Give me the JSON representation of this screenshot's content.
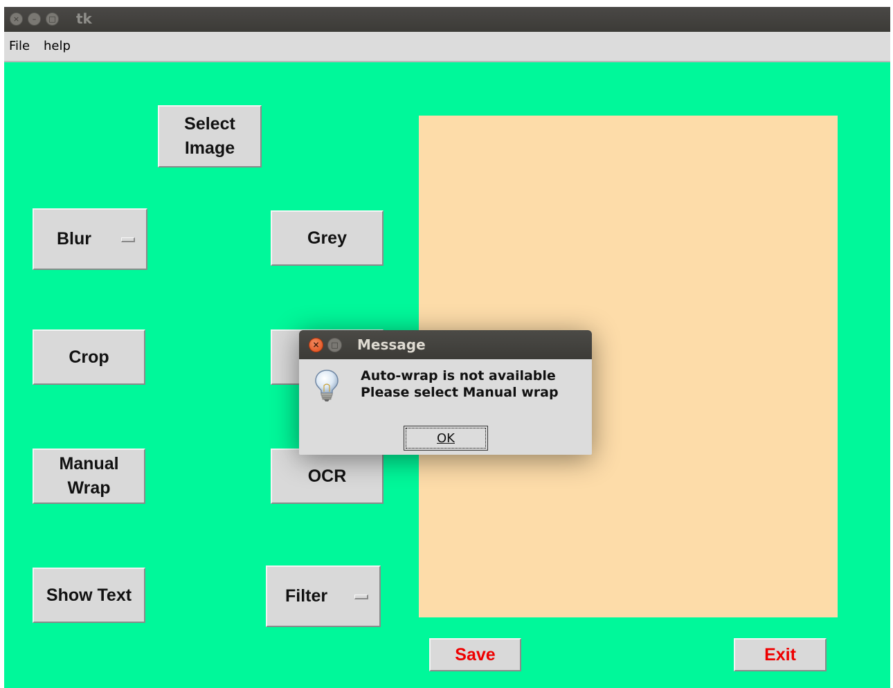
{
  "window": {
    "title": "tk"
  },
  "menubar": {
    "items": [
      "File",
      "help"
    ]
  },
  "buttons": {
    "select_image": "Select Image",
    "blur": "Blur",
    "grey": "Grey",
    "crop": "Crop",
    "manual_wrap": "Manual Wrap",
    "ocr": "OCR",
    "show_text": "Show Text",
    "filter": "Filter",
    "save": "Save",
    "exit": "Exit"
  },
  "dialog": {
    "title": "Message",
    "line1": "Auto-wrap is not available",
    "line2": "Please select Manual wrap",
    "ok_label": "OK",
    "icon": "lightbulb-icon"
  },
  "colors": {
    "window_background": "#00f89a",
    "canvas_background": "#fddca9",
    "button_background": "#d9d9d9",
    "danger_text": "#ee0000"
  }
}
